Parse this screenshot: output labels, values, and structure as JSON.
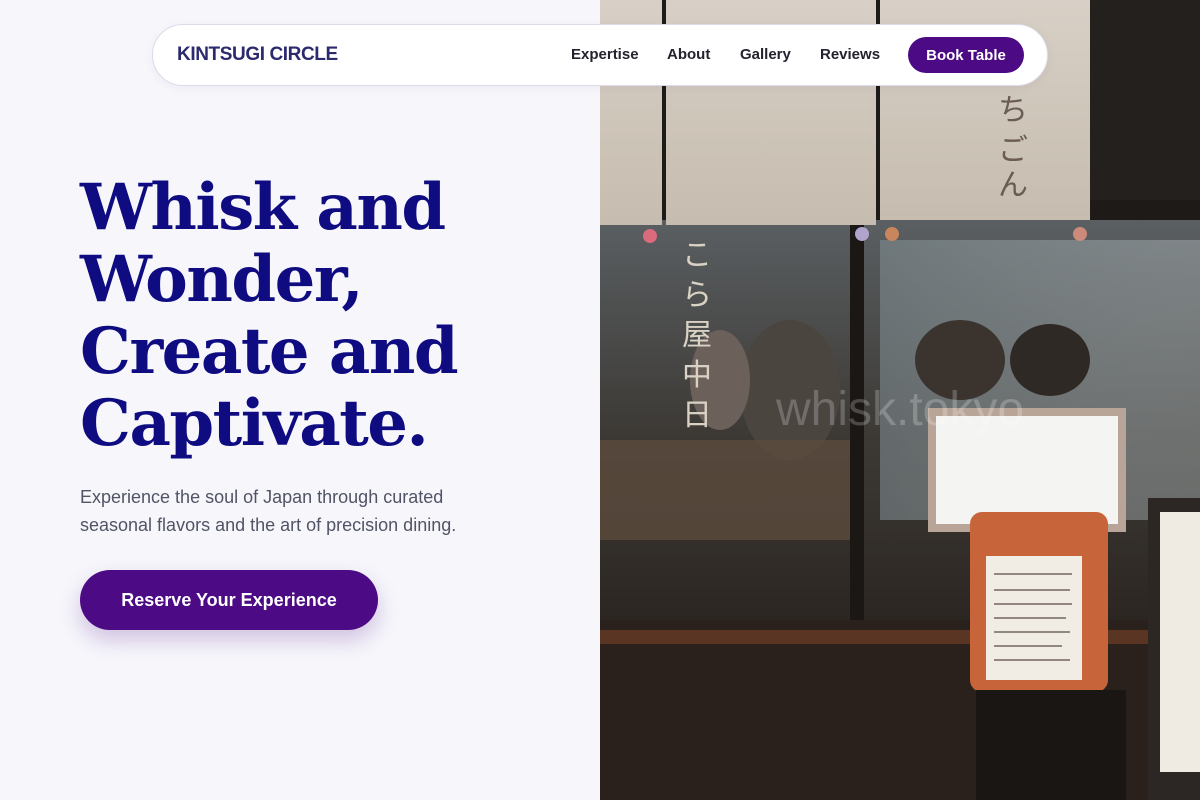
{
  "brand": "KINTSUGI CIRCLE",
  "nav": {
    "links": [
      "Expertise",
      "About",
      "Gallery",
      "Reviews"
    ],
    "book_label": "Book Table"
  },
  "hero": {
    "headline_lines": [
      "Whisk and",
      "Wonder,",
      "Create and",
      "Captivate."
    ],
    "subtitle_line1": "Experience the soul of Japan through curated",
    "subtitle_line2": "seasonal flavors and the art of precision dining.",
    "cta_label": "Reserve Your Experience"
  },
  "photo": {
    "watermark": "whisk.tokyo",
    "description_icon": "restaurant-storefront-image"
  },
  "colors": {
    "accent": "#4c0b85",
    "headline": "#0f0c82",
    "brand": "#2b2a6e",
    "background": "#f6f6fb"
  }
}
